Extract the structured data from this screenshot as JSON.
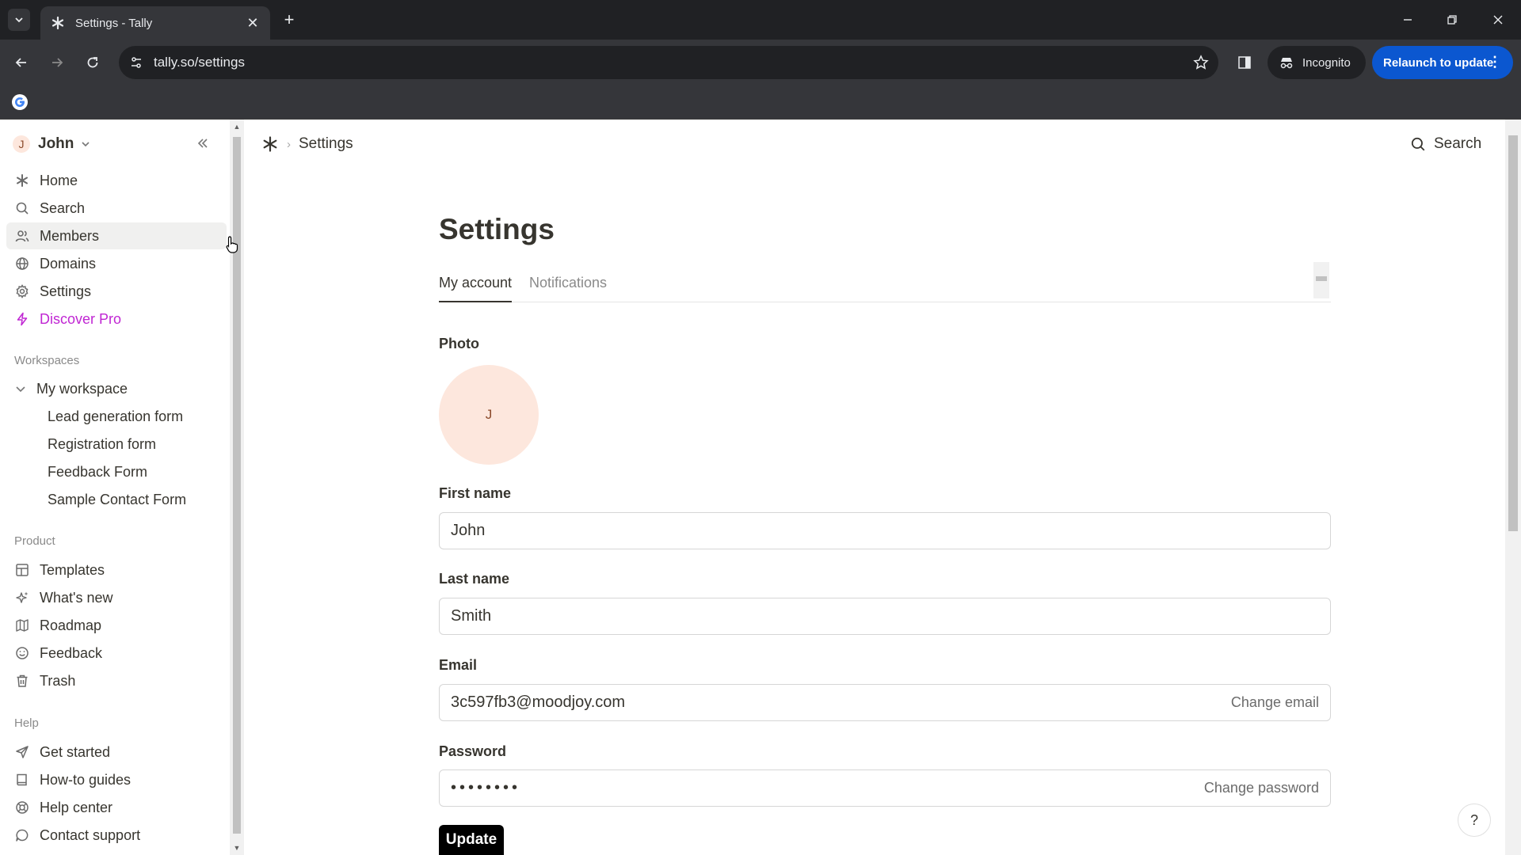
{
  "browser": {
    "tab_title": "Settings - Tally",
    "url": "tally.so/settings",
    "incognito_label": "Incognito",
    "relaunch_label": "Relaunch to update"
  },
  "sidebar": {
    "user": {
      "initial": "J",
      "name": "John"
    },
    "nav": [
      {
        "label": "Home",
        "icon": "tally-logo-icon"
      },
      {
        "label": "Search",
        "icon": "search-icon"
      },
      {
        "label": "Members",
        "icon": "members-icon"
      },
      {
        "label": "Domains",
        "icon": "globe-icon"
      },
      {
        "label": "Settings",
        "icon": "gear-icon"
      },
      {
        "label": "Discover Pro",
        "icon": "lightning-icon"
      }
    ],
    "workspaces_label": "Workspaces",
    "workspace_name": "My workspace",
    "forms": [
      "Lead generation form",
      "Registration form",
      "Feedback Form",
      "Sample Contact Form"
    ],
    "product_label": "Product",
    "product_items": [
      {
        "label": "Templates",
        "icon": "templates-icon"
      },
      {
        "label": "What's new",
        "icon": "sparkle-icon"
      },
      {
        "label": "Roadmap",
        "icon": "map-icon"
      },
      {
        "label": "Feedback",
        "icon": "smile-icon"
      },
      {
        "label": "Trash",
        "icon": "trash-icon"
      }
    ],
    "help_label": "Help",
    "help_items": [
      {
        "label": "Get started",
        "icon": "send-icon"
      },
      {
        "label": "How-to guides",
        "icon": "book-icon"
      },
      {
        "label": "Help center",
        "icon": "lifebuoy-icon"
      },
      {
        "label": "Contact support",
        "icon": "chat-icon"
      }
    ]
  },
  "header": {
    "breadcrumb_current": "Settings",
    "search_label": "Search"
  },
  "main": {
    "title": "Settings",
    "tabs": [
      {
        "label": "My account",
        "active": true
      },
      {
        "label": "Notifications",
        "active": false
      }
    ],
    "photo_label": "Photo",
    "photo_initial": "J",
    "first_name_label": "First name",
    "first_name_value": "John",
    "last_name_label": "Last name",
    "last_name_value": "Smith",
    "email_label": "Email",
    "email_value": "3c597fb3@moodjoy.com",
    "change_email_label": "Change email",
    "password_label": "Password",
    "password_value": "••••••••",
    "change_password_label": "Change password",
    "update_label": "Update",
    "help_glyph": "?"
  },
  "colors": {
    "accent_pro": "#c026d3",
    "relaunch_blue": "#0b57d0",
    "avatar_bg": "#fde7dd"
  }
}
